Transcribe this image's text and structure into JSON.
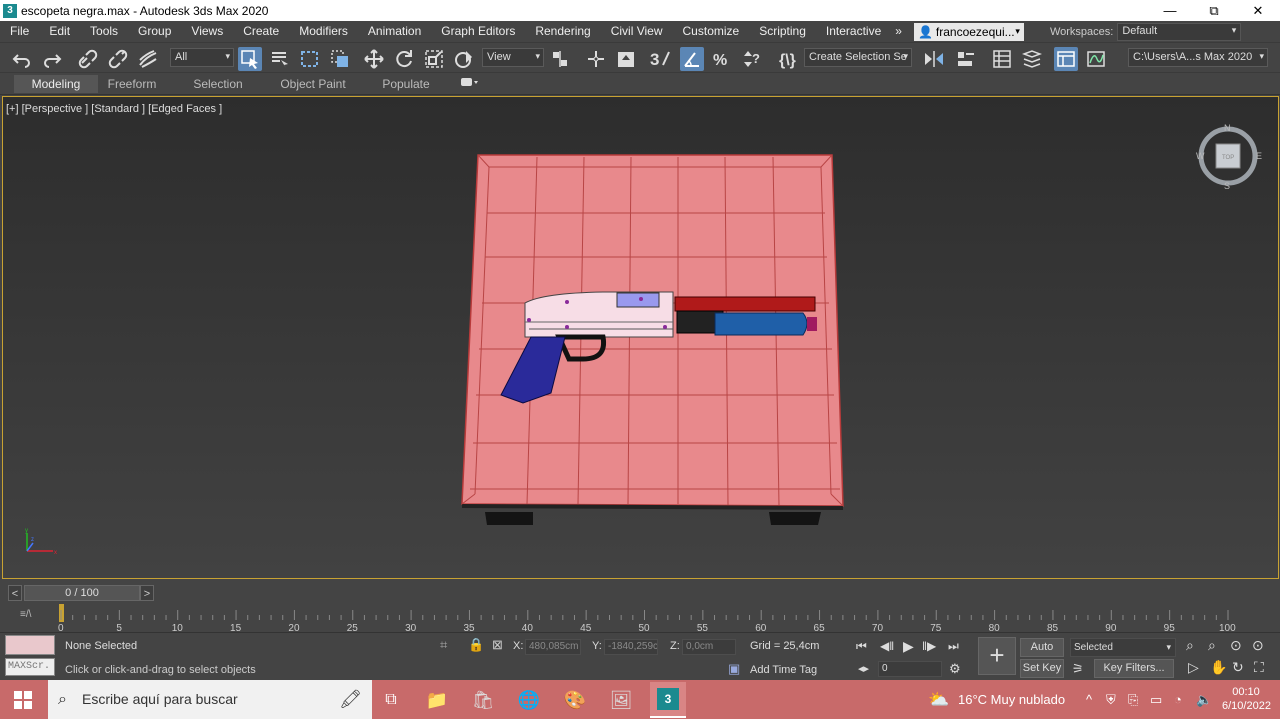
{
  "window": {
    "title": "escopeta negra.max - Autodesk 3ds Max 2020",
    "app_icon": "3",
    "minimize": "—",
    "restore": "⧉",
    "close": "✕"
  },
  "menu": {
    "items": [
      "File",
      "Edit",
      "Tools",
      "Group",
      "Views",
      "Create",
      "Modifiers",
      "Animation",
      "Graph Editors",
      "Rendering",
      "Civil View",
      "Customize",
      "Scripting",
      "Interactive"
    ],
    "overflow": "»",
    "user": "francoezequi...",
    "workspaces_label": "Workspaces:",
    "workspace": "Default"
  },
  "toolbar": {
    "filter": "All",
    "refcoord": "View",
    "named_selection": "Create Selection Se",
    "project_path": "C:\\Users\\A...s Max 2020"
  },
  "ribbon": {
    "tabs": [
      "Modeling",
      "Freeform",
      "Selection",
      "Object Paint",
      "Populate"
    ],
    "active": "Modeling"
  },
  "viewport": {
    "label": "[+] [Perspective ] [Standard ] [Edged Faces ]",
    "viewcube": {
      "face": "TOP",
      "n": "N",
      "s": "S",
      "e": "E",
      "w": "W"
    },
    "axis": {
      "x": "x",
      "y": "y",
      "z": "z"
    }
  },
  "time": {
    "frame": "0 / 100",
    "ticks": [
      "0",
      "5",
      "10",
      "15",
      "20",
      "25",
      "30",
      "35",
      "40",
      "45",
      "50",
      "55",
      "60",
      "65",
      "70",
      "75",
      "80",
      "85",
      "90",
      "95",
      "100"
    ],
    "prev": "<",
    "next": ">",
    "mini_listener": "≡/\\"
  },
  "status": {
    "selection": "None Selected",
    "prompt": "Click or click-and-drag to select objects",
    "maxscript": "MAXScr.",
    "x_label": "X:",
    "x": "480,085cm",
    "y_label": "Y:",
    "y": "-1840,259c",
    "z_label": "Z:",
    "z": "0,0cm",
    "grid": "Grid = 25,4cm",
    "add_time_tag": "Add Time Tag",
    "auto_key": "Auto Key",
    "set_key": "Set Key",
    "key_mode": "Selected",
    "key_filters": "Key Filters...",
    "frame_field": "0"
  },
  "taskbar": {
    "search": "Escribe aquí para buscar",
    "weather": "16°C  Muy nublado",
    "time": "00:10",
    "date": "6/10/2022"
  },
  "colors": {
    "accent": "#5b86b5",
    "viewport_border": "#c8a232",
    "table": "#e8898c",
    "taskbar": "#c86a6a"
  }
}
